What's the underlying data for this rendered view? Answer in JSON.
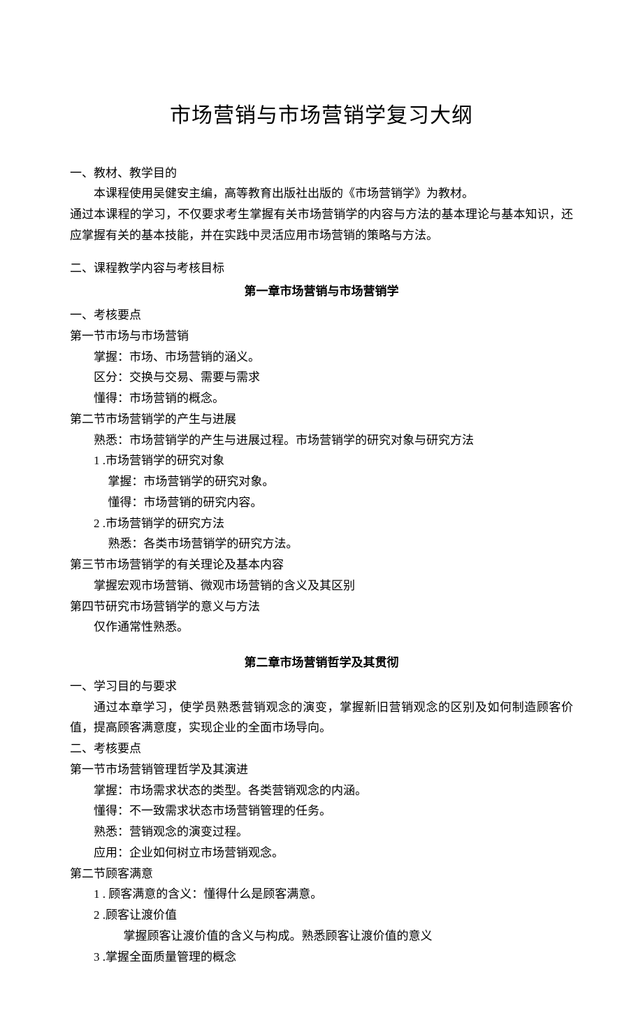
{
  "title": "市场营销与市场营销学复习大纲",
  "sec1": {
    "head": "一、教材、教学目的",
    "p1": "本课程使用吴健安主编，高等教育出版社出版的《市场营销学》为教材。",
    "p2": "通过本课程的学习，不仅要求考生掌握有关市场营销学的内容与方法的基本理论与基本知识，还应掌握有关的基本技能，并在实践中灵活应用市场营销的策略与方法。"
  },
  "sec2": {
    "head": "二、课程教学内容与考核目标"
  },
  "ch1": {
    "title": "第一章市场营销与市场营销学",
    "kh": "一、考核要点",
    "s1": {
      "head": "第一节市场与市场营销",
      "l1": "掌握：市场、市场营销的涵义。",
      "l2": "区分：交换与交易、需要与需求",
      "l3": "懂得：市场营销的概念。"
    },
    "s2": {
      "head": "第二节市场营销学的产生与进展",
      "l1": "熟悉：市场营销学的产生与进展过程。市场营销学的研究对象与研究方法",
      "n1": "1 .市场营销学的研究对象",
      "n1a": "掌握：市场营销学的研究对象。",
      "n1b": "懂得：市场营销的研究内容。",
      "n2": "2 .市场营销学的研究方法",
      "n2a": "熟悉：各类市场营销学的研究方法。"
    },
    "s3": {
      "head": "第三节市场营销学的有关理论及基本内容",
      "l1": "掌握宏观市场营销、微观市场营销的含义及其区别"
    },
    "s4": {
      "head": "第四节研究市场营销学的意义与方法",
      "l1": "仅作通常性熟悉。"
    }
  },
  "ch2": {
    "title": "第二章市场营销哲学及其贯彻",
    "a1": "一、学习目的与要求",
    "a1p": "通过本章学习，使学员熟悉营销观念的演变，掌握新旧营销观念的区别及如何制造顾客价值，提高顾客满意度，实现企业的全面市场导向。",
    "a2": "二、考核要点",
    "s1": {
      "head": "第一节市场营销管理哲学及其演进",
      "l1": "掌握：市场需求状态的类型。各类营销观念的内涵。",
      "l2": "懂得：不一致需求状态市场营销管理的任务。",
      "l3": "熟悉：营销观念的演变过程。",
      "l4": "应用：企业如何树立市场营销观念。"
    },
    "s2": {
      "head": "第二节顾客满意",
      "n1": "1 . 顾客满意的含义：懂得什么是顾客满意。",
      "n2": "2 .顾客让渡价值",
      "n2a": "掌握顾客让渡价值的含义与构成。熟悉顾客让渡价值的意义",
      "n3": "3 .掌握全面质量管理的概念"
    }
  }
}
